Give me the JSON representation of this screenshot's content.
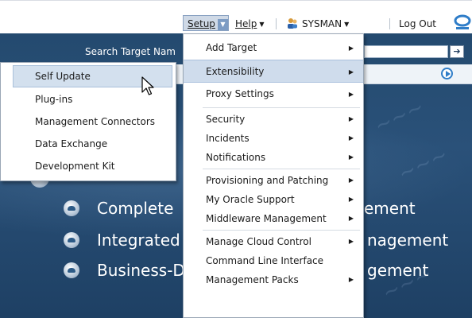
{
  "topbar": {
    "setup_label": "Setup",
    "help_label": "Help",
    "user_label": "SYSMAN",
    "logout_label": "Log Out"
  },
  "search": {
    "label": "Search Target Nam",
    "placeholder": ""
  },
  "hero": {
    "lines": [
      {
        "left": "Complete",
        "right": "ement"
      },
      {
        "left": "Integrated",
        "right": "nagement"
      },
      {
        "left": "Business-D",
        "right": "gement"
      }
    ]
  },
  "setup_menu": {
    "items": [
      {
        "label": "Add Target",
        "submenu": true
      },
      {
        "label": "Extensibility",
        "submenu": true,
        "highlighted": true
      },
      {
        "label": "Proxy Settings",
        "submenu": true
      },
      {
        "label": "Security",
        "submenu": true
      },
      {
        "label": "Incidents",
        "submenu": true
      },
      {
        "label": "Notifications",
        "submenu": true
      },
      {
        "label": "Provisioning and Patching",
        "submenu": true
      },
      {
        "label": "My Oracle Support",
        "submenu": true
      },
      {
        "label": "Middleware Management",
        "submenu": true
      },
      {
        "label": "Manage Cloud Control",
        "submenu": true
      },
      {
        "label": "Command Line Interface",
        "submenu": false
      },
      {
        "label": "Management Packs",
        "submenu": true
      }
    ]
  },
  "extensibility_menu": {
    "items": [
      {
        "label": "Self Update",
        "highlighted": true
      },
      {
        "label": "Plug-ins"
      },
      {
        "label": "Management Connectors"
      },
      {
        "label": "Data Exchange"
      },
      {
        "label": "Development Kit"
      }
    ]
  },
  "colors": {
    "hero_bg": "#244a6f",
    "menu_highlight": "#cfdcec",
    "accent": "#2f7dc8"
  },
  "icons": [
    "user-icon",
    "oracle-logo-icon",
    "go-arrow-icon",
    "play-circle-icon",
    "submenu-arrow-icon",
    "mouse-pointer-icon"
  ]
}
